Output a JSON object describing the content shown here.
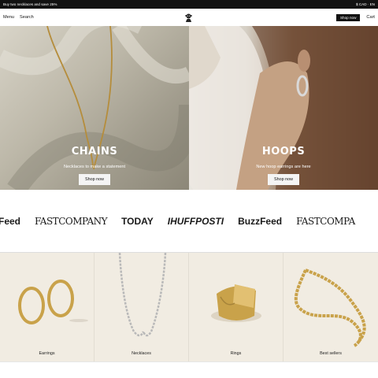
{
  "announcement": {
    "left_text": "Buy two necklaces and save 25%",
    "right_text": "$ CAD · EN"
  },
  "header": {
    "menu_label": "Menu",
    "search_label": "Search",
    "shop_label": "Shop now",
    "cart_label": "Cart",
    "logo_icon": "monkey-logo-icon"
  },
  "heroes": [
    {
      "title": "CHAINS",
      "subtitle": "Necklaces to make a statement",
      "button": "Shop now"
    },
    {
      "title": "HOOPS",
      "subtitle": "New hoop earrings are here",
      "button": "Shop now"
    }
  ],
  "press": [
    "zFeed",
    "FASTCOMPANY",
    "TODAY",
    "IHUFFPOSTI",
    "BuzzFeed",
    "FASTCOMPA"
  ],
  "categories": [
    {
      "label": "Earrings"
    },
    {
      "label": "Necklaces"
    },
    {
      "label": "Rings"
    },
    {
      "label": "Best sellers"
    }
  ],
  "colors": {
    "dark": "#121212",
    "gold": "#c9a24a",
    "silver": "#c8c8c8",
    "category_bg": "#f1ece2"
  }
}
